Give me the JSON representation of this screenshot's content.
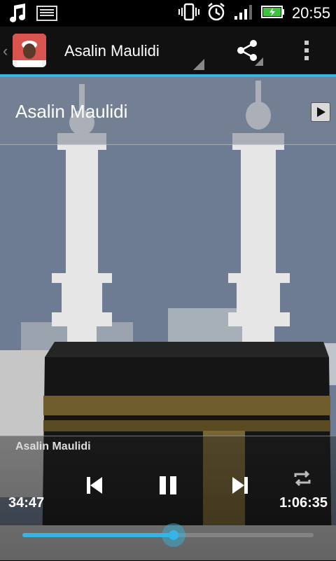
{
  "status_bar": {
    "time": "20:55"
  },
  "action_bar": {
    "title": "Asalin Maulidi"
  },
  "track_header": {
    "title": "Asalin Maulidi"
  },
  "player": {
    "track_name": "Asalin Maulidi",
    "elapsed": "34:47",
    "total": "1:06:35",
    "progress": 0.52
  },
  "colors": {
    "accent": "#33b5e5"
  },
  "icons": [
    "music-note-icon",
    "keyboard-icon",
    "vibrate-icon",
    "alarm-icon",
    "signal-icon",
    "battery-icon",
    "share-icon",
    "overflow-menu-icon",
    "play-icon",
    "previous-icon",
    "pause-icon",
    "next-icon",
    "repeat-icon"
  ]
}
